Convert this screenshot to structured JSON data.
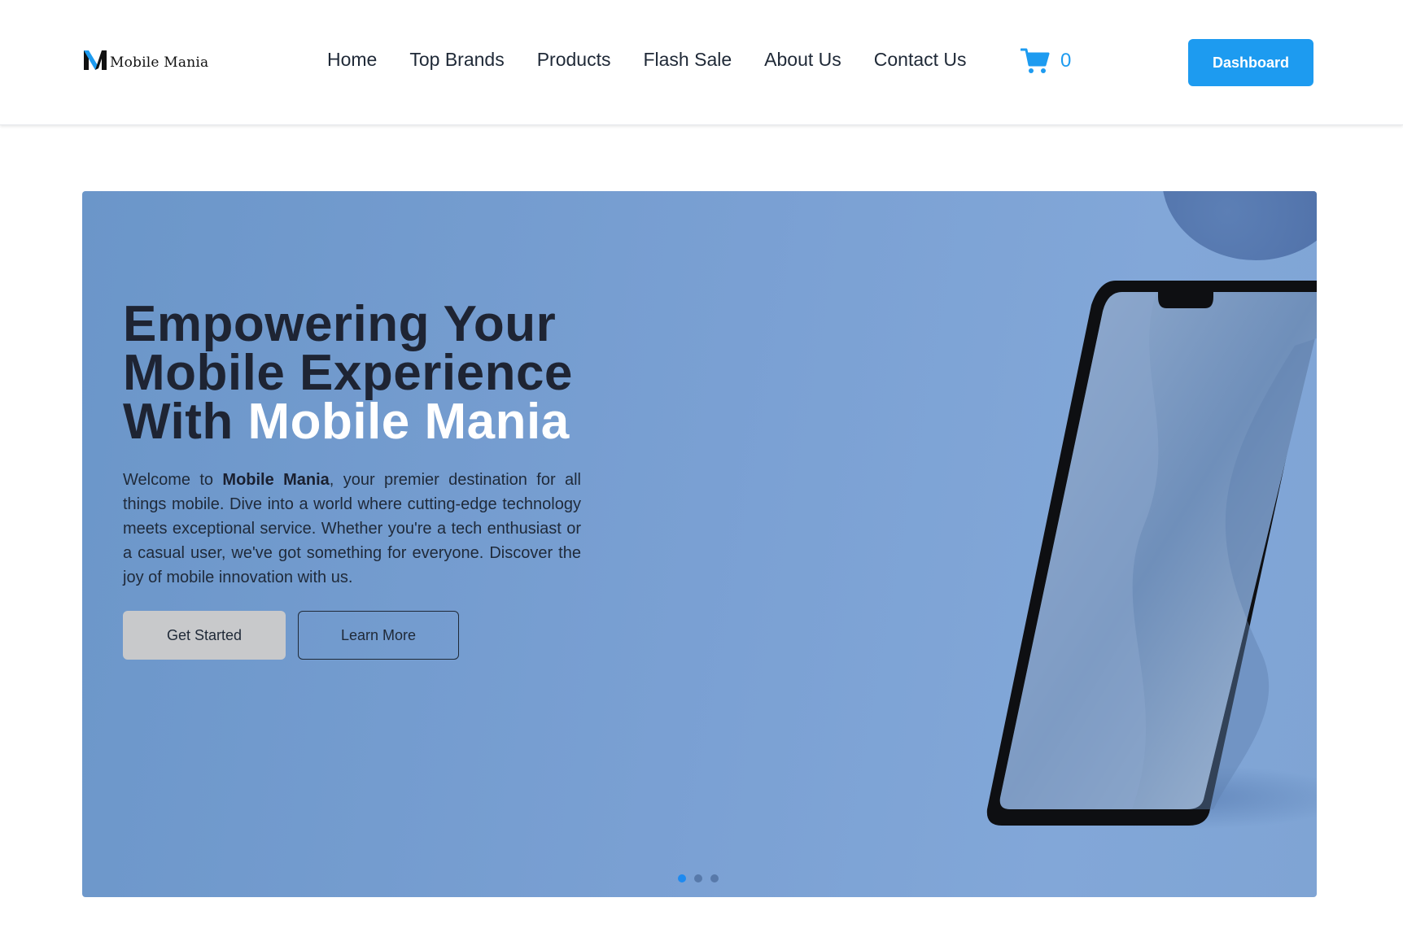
{
  "brand": {
    "name": "Mobile Mania",
    "accent_color": "#1d9bf0"
  },
  "nav": {
    "items": [
      {
        "label": "Home"
      },
      {
        "label": "Top Brands"
      },
      {
        "label": "Products"
      },
      {
        "label": "Flash Sale"
      },
      {
        "label": "About Us"
      },
      {
        "label": "Contact Us"
      }
    ]
  },
  "cart": {
    "icon": "cart-icon",
    "count": "0"
  },
  "header": {
    "dashboard_label": "Dashboard"
  },
  "hero": {
    "title_line1": "Empowering Your",
    "title_line2": "Mobile Experience",
    "title_line3_prefix": "With ",
    "title_line3_accent": "Mobile Mania",
    "desc_prefix": "Welcome to ",
    "desc_brand": "Mobile Mania",
    "desc_rest": ", your premier destination for all things mobile. Dive into a world where cutting-edge technology meets exceptional service. Whether you're a tech enthusiast or a casual user, we've got something for everyone. Discover the joy of mobile innovation with us.",
    "get_started_label": "Get Started",
    "learn_more_label": "Learn More",
    "carousel": {
      "slides": 3,
      "active_index": 0
    }
  }
}
